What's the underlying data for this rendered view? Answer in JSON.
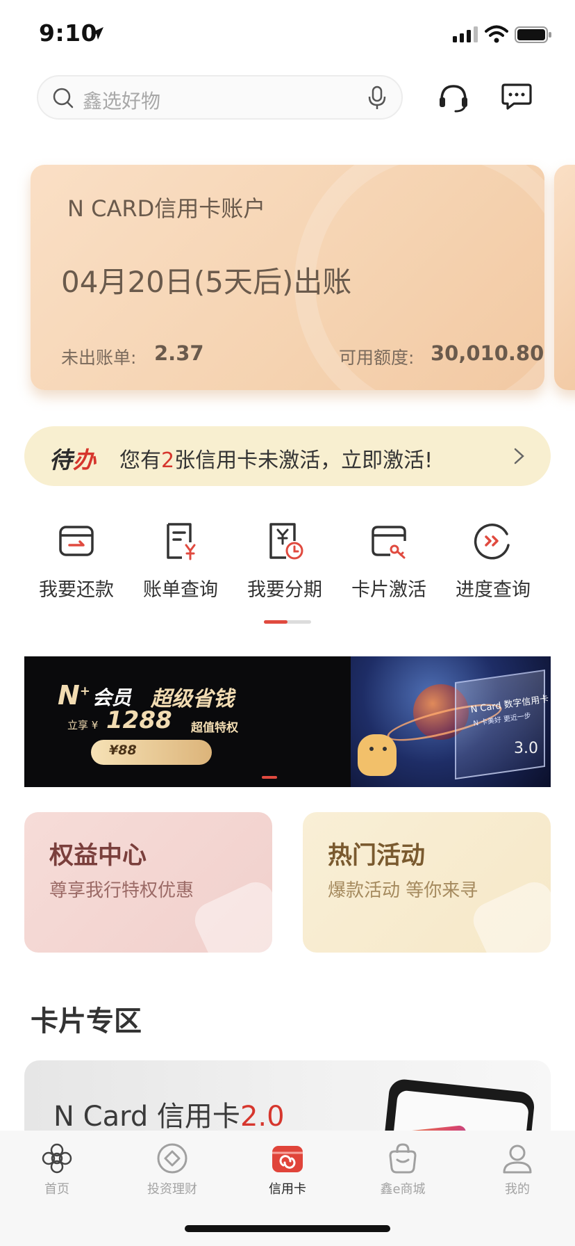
{
  "status_bar": {
    "time": "9:10"
  },
  "search": {
    "placeholder": "鑫选好物"
  },
  "account_card": {
    "title": "N CARD信用卡账户",
    "due_text": "04月20日(5天后)出账",
    "unbilled_label": "未出账单:",
    "unbilled_value": "2.37",
    "available_label": "可用额度:",
    "available_value": "30,010.80"
  },
  "todo": {
    "tag_part1": "待",
    "tag_part2": "办",
    "text_before": "您有",
    "count": "2",
    "text_after": "张信用卡未激活，立即激活!"
  },
  "quick_actions": [
    {
      "label": "我要还款",
      "icon": "repay-icon"
    },
    {
      "label": "账单查询",
      "icon": "bill-query-icon"
    },
    {
      "label": "我要分期",
      "icon": "installment-icon"
    },
    {
      "label": "卡片激活",
      "icon": "card-activate-icon"
    },
    {
      "label": "进度查询",
      "icon": "progress-query-icon"
    }
  ],
  "promo_banner": {
    "logo": "N",
    "logo_sup": "+",
    "member": "会员",
    "headline": "超级省钱",
    "enjoy": "立享 ¥",
    "amount": "1288",
    "super": "超值特权",
    "price": "¥88",
    "card_title": "N Card 数字信用卡",
    "card_sub": "N 卡美好 更近一步",
    "card_version": "3.0"
  },
  "tiles": {
    "rights": {
      "title": "权益中心",
      "desc": "尊享我行特权优惠"
    },
    "hot": {
      "title": "热门活动",
      "desc": "爆款活动 等你来寻"
    }
  },
  "card_zone": {
    "section_title": "卡片专区",
    "promo_title": "N Card 信用卡",
    "promo_version": "2.0"
  },
  "tab_bar": [
    {
      "label": "首页",
      "icon": "home-flower-icon",
      "active": false
    },
    {
      "label": "投资理财",
      "icon": "invest-icon",
      "active": false
    },
    {
      "label": "信用卡",
      "icon": "credit-card-icon",
      "active": true
    },
    {
      "label": "鑫e商城",
      "icon": "shop-bag-icon",
      "active": false
    },
    {
      "label": "我的",
      "icon": "profile-icon",
      "active": false
    }
  ],
  "colors": {
    "accent_red": "#d6362d",
    "card_gold": "#f5d3b1",
    "todo_bg": "#f8efd0"
  }
}
